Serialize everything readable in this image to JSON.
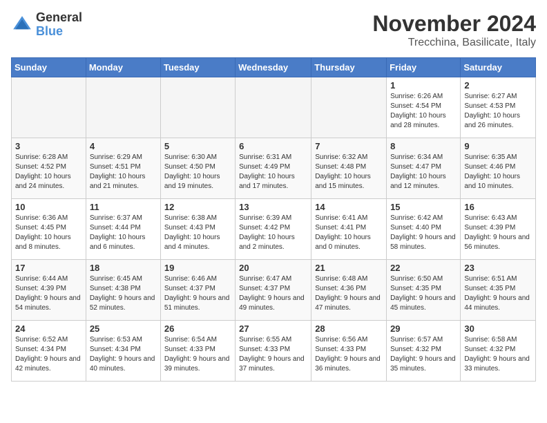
{
  "logo": {
    "general": "General",
    "blue": "Blue"
  },
  "title": "November 2024",
  "location": "Trecchina, Basilicate, Italy",
  "headers": [
    "Sunday",
    "Monday",
    "Tuesday",
    "Wednesday",
    "Thursday",
    "Friday",
    "Saturday"
  ],
  "weeks": [
    [
      {
        "day": "",
        "empty": true
      },
      {
        "day": "",
        "empty": true
      },
      {
        "day": "",
        "empty": true
      },
      {
        "day": "",
        "empty": true
      },
      {
        "day": "",
        "empty": true
      },
      {
        "day": "1",
        "info": "Sunrise: 6:26 AM\nSunset: 4:54 PM\nDaylight: 10 hours and 28 minutes."
      },
      {
        "day": "2",
        "info": "Sunrise: 6:27 AM\nSunset: 4:53 PM\nDaylight: 10 hours and 26 minutes."
      }
    ],
    [
      {
        "day": "3",
        "info": "Sunrise: 6:28 AM\nSunset: 4:52 PM\nDaylight: 10 hours and 24 minutes."
      },
      {
        "day": "4",
        "info": "Sunrise: 6:29 AM\nSunset: 4:51 PM\nDaylight: 10 hours and 21 minutes."
      },
      {
        "day": "5",
        "info": "Sunrise: 6:30 AM\nSunset: 4:50 PM\nDaylight: 10 hours and 19 minutes."
      },
      {
        "day": "6",
        "info": "Sunrise: 6:31 AM\nSunset: 4:49 PM\nDaylight: 10 hours and 17 minutes."
      },
      {
        "day": "7",
        "info": "Sunrise: 6:32 AM\nSunset: 4:48 PM\nDaylight: 10 hours and 15 minutes."
      },
      {
        "day": "8",
        "info": "Sunrise: 6:34 AM\nSunset: 4:47 PM\nDaylight: 10 hours and 12 minutes."
      },
      {
        "day": "9",
        "info": "Sunrise: 6:35 AM\nSunset: 4:46 PM\nDaylight: 10 hours and 10 minutes."
      }
    ],
    [
      {
        "day": "10",
        "info": "Sunrise: 6:36 AM\nSunset: 4:45 PM\nDaylight: 10 hours and 8 minutes."
      },
      {
        "day": "11",
        "info": "Sunrise: 6:37 AM\nSunset: 4:44 PM\nDaylight: 10 hours and 6 minutes."
      },
      {
        "day": "12",
        "info": "Sunrise: 6:38 AM\nSunset: 4:43 PM\nDaylight: 10 hours and 4 minutes."
      },
      {
        "day": "13",
        "info": "Sunrise: 6:39 AM\nSunset: 4:42 PM\nDaylight: 10 hours and 2 minutes."
      },
      {
        "day": "14",
        "info": "Sunrise: 6:41 AM\nSunset: 4:41 PM\nDaylight: 10 hours and 0 minutes."
      },
      {
        "day": "15",
        "info": "Sunrise: 6:42 AM\nSunset: 4:40 PM\nDaylight: 9 hours and 58 minutes."
      },
      {
        "day": "16",
        "info": "Sunrise: 6:43 AM\nSunset: 4:39 PM\nDaylight: 9 hours and 56 minutes."
      }
    ],
    [
      {
        "day": "17",
        "info": "Sunrise: 6:44 AM\nSunset: 4:39 PM\nDaylight: 9 hours and 54 minutes."
      },
      {
        "day": "18",
        "info": "Sunrise: 6:45 AM\nSunset: 4:38 PM\nDaylight: 9 hours and 52 minutes."
      },
      {
        "day": "19",
        "info": "Sunrise: 6:46 AM\nSunset: 4:37 PM\nDaylight: 9 hours and 51 minutes."
      },
      {
        "day": "20",
        "info": "Sunrise: 6:47 AM\nSunset: 4:37 PM\nDaylight: 9 hours and 49 minutes."
      },
      {
        "day": "21",
        "info": "Sunrise: 6:48 AM\nSunset: 4:36 PM\nDaylight: 9 hours and 47 minutes."
      },
      {
        "day": "22",
        "info": "Sunrise: 6:50 AM\nSunset: 4:35 PM\nDaylight: 9 hours and 45 minutes."
      },
      {
        "day": "23",
        "info": "Sunrise: 6:51 AM\nSunset: 4:35 PM\nDaylight: 9 hours and 44 minutes."
      }
    ],
    [
      {
        "day": "24",
        "info": "Sunrise: 6:52 AM\nSunset: 4:34 PM\nDaylight: 9 hours and 42 minutes."
      },
      {
        "day": "25",
        "info": "Sunrise: 6:53 AM\nSunset: 4:34 PM\nDaylight: 9 hours and 40 minutes."
      },
      {
        "day": "26",
        "info": "Sunrise: 6:54 AM\nSunset: 4:33 PM\nDaylight: 9 hours and 39 minutes."
      },
      {
        "day": "27",
        "info": "Sunrise: 6:55 AM\nSunset: 4:33 PM\nDaylight: 9 hours and 37 minutes."
      },
      {
        "day": "28",
        "info": "Sunrise: 6:56 AM\nSunset: 4:33 PM\nDaylight: 9 hours and 36 minutes."
      },
      {
        "day": "29",
        "info": "Sunrise: 6:57 AM\nSunset: 4:32 PM\nDaylight: 9 hours and 35 minutes."
      },
      {
        "day": "30",
        "info": "Sunrise: 6:58 AM\nSunset: 4:32 PM\nDaylight: 9 hours and 33 minutes."
      }
    ]
  ]
}
